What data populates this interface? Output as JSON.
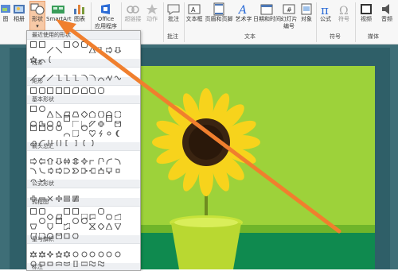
{
  "ribbon": {
    "buttons": [
      {
        "id": "partial",
        "label": "图",
        "icon": "picture-icon"
      },
      {
        "id": "album",
        "label": "相册",
        "icon": "album-icon"
      },
      {
        "id": "shape",
        "label": "形状",
        "icon": "shapes-icon",
        "active": true
      },
      {
        "id": "smartart",
        "label": "SmartArt",
        "icon": "smartart-icon"
      },
      {
        "id": "chart",
        "label": "图表",
        "icon": "chart-icon"
      },
      {
        "id": "office",
        "label": "Office",
        "label2": "应用程序",
        "icon": "office-store-icon"
      },
      {
        "id": "hyperlink",
        "label": "超链接",
        "icon": "link-icon"
      },
      {
        "id": "action",
        "label": "动作",
        "icon": "action-icon"
      },
      {
        "id": "comment",
        "label": "批注",
        "icon": "comment-icon"
      },
      {
        "id": "textbox",
        "label": "文本框",
        "icon": "textbox-icon"
      },
      {
        "id": "headerfooter",
        "label": "页眉和页脚",
        "icon": "header-footer-icon"
      },
      {
        "id": "wordart",
        "label": "艺术字",
        "icon": "wordart-icon"
      },
      {
        "id": "datetime",
        "label": "日期和时间",
        "icon": "calendar-icon"
      },
      {
        "id": "slidenumber",
        "label": "幻灯片",
        "label2": "编号",
        "icon": "slide-number-icon"
      },
      {
        "id": "object",
        "label": "对象",
        "icon": "object-icon"
      },
      {
        "id": "equation",
        "label": "公式",
        "icon": "pi-icon"
      },
      {
        "id": "symbol",
        "label": "符号",
        "icon": "omega-icon"
      },
      {
        "id": "video",
        "label": "视频",
        "icon": "video-icon"
      },
      {
        "id": "audio",
        "label": "音频",
        "icon": "audio-icon"
      }
    ],
    "groups": {
      "comments": "批注",
      "text": "文本",
      "symbols": "符号",
      "media": "媒体"
    },
    "colors": {
      "active_bg": "#f7c9a6",
      "accent_blue": "#2b6bd6"
    }
  },
  "shapes_menu": {
    "categories": [
      {
        "label": "最近使用的形状",
        "rows": 2
      },
      {
        "label": "线条",
        "rows": 1
      },
      {
        "label": "矩形",
        "rows": 1
      },
      {
        "label": "基本形状",
        "rows": 4
      },
      {
        "label": "箭头总汇",
        "rows": 3
      },
      {
        "label": "公式形状",
        "rows": 1
      },
      {
        "label": "流程图",
        "rows": 3
      },
      {
        "label": "星与旗帜",
        "rows": 2
      },
      {
        "label": "标注",
        "rows": 1
      }
    ]
  },
  "annotation": {
    "arrow_color": "#f07f2e"
  }
}
